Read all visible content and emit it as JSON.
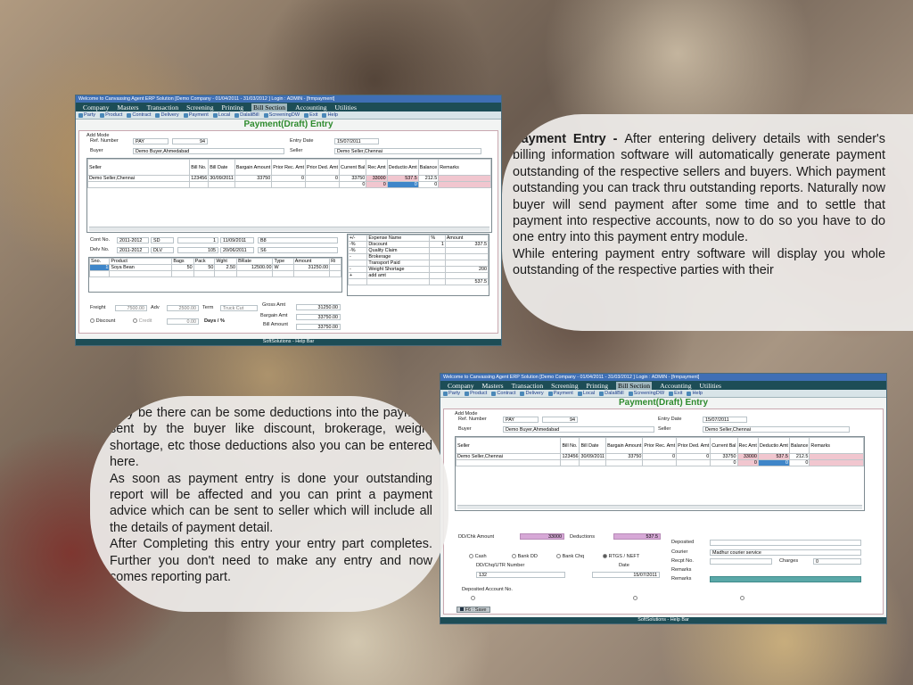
{
  "win1": {
    "title": "Welcome to Canvassing Agent ERP Solution [Demo Company - 01/04/2011 - 31/03/2012 ] Login : ADMIN - [frmpayment]",
    "menu": [
      "Company",
      "Masters",
      "Transaction",
      "Screening",
      "Printing",
      "Bill Section",
      "Accounting",
      "Utilities"
    ],
    "toolbar": [
      "Party",
      "Product",
      "Contract",
      "Delivery",
      "Payment",
      "Local",
      "DalaliBill",
      "ScreeningDW",
      "Exit",
      "Help"
    ],
    "form_title": "Payment(Draft) Entry",
    "mode": "Add Mode",
    "ref_label": "Ref. Number",
    "ref_type": "PAY",
    "ref_no": "94",
    "entry_date_label": "Entry Date",
    "entry_date": "15/07/2011",
    "buyer_label": "Buyer",
    "buyer": "Demo Buyer,Ahmedabad",
    "seller_label": "Seller",
    "seller": "Demo Seller,Chennai",
    "grid_headers": [
      "Seller",
      "Bill No.",
      "Bill Date",
      "Bargain Amount",
      "Prior Rec. Amt",
      "Prior Ded. Amt",
      "Current Bal",
      "Rec Amt",
      "Deductio Amt",
      "Balance",
      "Remarks"
    ],
    "grid_rows": [
      [
        "Demo Seller,Chennai",
        "123456",
        "30/09/2011",
        "33750",
        "0",
        "0",
        "33750",
        "33000",
        "537.5",
        "212.5",
        ""
      ],
      [
        "",
        "",
        "",
        "",
        "",
        "",
        "0",
        "0",
        "0",
        "0",
        ""
      ]
    ],
    "cont_label": "Cont No.",
    "cont_no": "2011-2012",
    "cont_type": "SD",
    "cont_num": "1",
    "cont_date": "11/09/2011",
    "cont_extra": "B8",
    "delv_label": "Delv No.",
    "delv_no": "2011-2012",
    "delv_type": "DLV",
    "delv_num": "105",
    "delv_date": "20/06/2011",
    "delv_extra": "S6",
    "prod_headers": [
      "Sno.",
      "Product",
      "Bags",
      "Pack",
      "Wght",
      "BRate",
      "Type",
      "Amount",
      "Ri"
    ],
    "prod_row": [
      "1",
      "Soya Bean",
      "50",
      "50",
      "2.50",
      "12500.00",
      "W",
      "31250.00"
    ],
    "expense_headers": [
      "+/-",
      "Expense Name",
      "%",
      "Amount"
    ],
    "expenses": [
      [
        "-%",
        "Discount",
        "1",
        "337.5"
      ],
      [
        "-%",
        "Quality Claim",
        "",
        ""
      ],
      [
        "-",
        "Brokerage",
        "",
        ""
      ],
      [
        "",
        "Transport Paid",
        "",
        ""
      ],
      [
        "-",
        "Weight Shortage",
        "",
        "200"
      ],
      [
        "+",
        "add amt",
        "",
        ""
      ]
    ],
    "expense_total": "537.5",
    "freight_label": "Freight",
    "freight": "7500.00",
    "adv_label": "Adv",
    "adv": "2500.00",
    "term_label": "Term",
    "term": "Truck Cut",
    "gross_label": "Gross Amt",
    "gross": "31250.00",
    "bargain_label": "Bargain Amt",
    "bargain": "33750.00",
    "bill_label": "Bill Amount",
    "bill": "33750.00",
    "discount_label": "Discount",
    "credit_label": "Credit",
    "credit_val": "0.00",
    "days_label": "Days / %",
    "status": "SoftSolutions - Help Bar"
  },
  "win2": {
    "title": "Welcome to Canvassing Agent ERP Solution [Demo Company - 01/04/2011 - 31/03/2012 ] Login : ADMIN - [frmpayment]",
    "menu": [
      "Company",
      "Masters",
      "Transaction",
      "Screening",
      "Printing",
      "Bill Section",
      "Accounting",
      "Utilities"
    ],
    "toolbar": [
      "Party",
      "Product",
      "Contract",
      "Delivery",
      "Payment",
      "Local",
      "DalaliBill",
      "ScreeningDW",
      "Exit",
      "Help"
    ],
    "form_title": "Payment(Draft) Entry",
    "mode": "Add Mode",
    "ref_label": "Ref. Number",
    "ref_type": "PAY",
    "ref_no": "94",
    "entry_date_label": "Entry Date",
    "entry_date": "15/07/2011",
    "buyer_label": "Buyer",
    "buyer": "Demo Buyer,Ahmedabad",
    "seller_label": "Seller",
    "seller": "Demo Seller,Chennai",
    "grid_headers": [
      "Seller",
      "Bill No.",
      "Bill Date",
      "Bargain Amount",
      "Prior Rec. Amt",
      "Prior Ded. Amt",
      "Current Bal",
      "Rec Amt",
      "Deductio Amt",
      "Balance",
      "Remarks"
    ],
    "grid_rows": [
      [
        "Demo Seller,Chennai",
        "123456",
        "30/09/2011",
        "33750",
        "0",
        "0",
        "33750",
        "33000",
        "537.5",
        "212.5",
        ""
      ],
      [
        "",
        "",
        "",
        "",
        "",
        "",
        "0",
        "0",
        "0",
        "0",
        ""
      ]
    ],
    "dd_label": "DD/Chk Amount",
    "dd_amount": "33000",
    "ded_label": "Deductions",
    "ded_amount": "537.5",
    "pay_modes": [
      "Cash",
      "Bank DD",
      "Bank Chq",
      "RTGS / NEFT"
    ],
    "utr_label": "DD/Chq/UTR Number",
    "utr": "132",
    "date_label": "Date",
    "date": "15/07/2011",
    "deposited_label": "Deposited",
    "courier_label": "Courier",
    "courier": "Madhur courier service",
    "recpt_label": "Recpt No.",
    "charges_label": "Charges",
    "charges": "0",
    "remarks_label": "Remarks",
    "remarks2_label": "Remarks",
    "dep_acc_label": "Deposited Account No.",
    "save_label": "F6 : Save",
    "status": "SoftSolutions - Help Bar"
  },
  "text1": {
    "heading": "Payment Entry - ",
    "p1": "After entering delivery details with sender's billing information software will automatically generate payment outstanding of the respective sellers and buyers. Which payment outstanding you can track thru outstanding reports. Naturally now buyer will send payment after some time and to settle that payment into respective accounts, now to do so you have to do one entry into this payment entry module.",
    "p2": "While entering payment entry software will display you whole outstanding of the respective parties with their"
  },
  "text2": {
    "p1": "May be there can be some deductions into the payment sent by the buyer like discount, brokerage, weight shortage, etc those deductions also you can be entered here.",
    "p2": "As soon as payment entry is done your outstanding report will be affected and you can print a payment advice which can be sent to seller which will include all the details of payment detail.",
    "p3": "After Completing this entry your entry part completes. Further you don't need to make any entry and now comes reporting part."
  }
}
